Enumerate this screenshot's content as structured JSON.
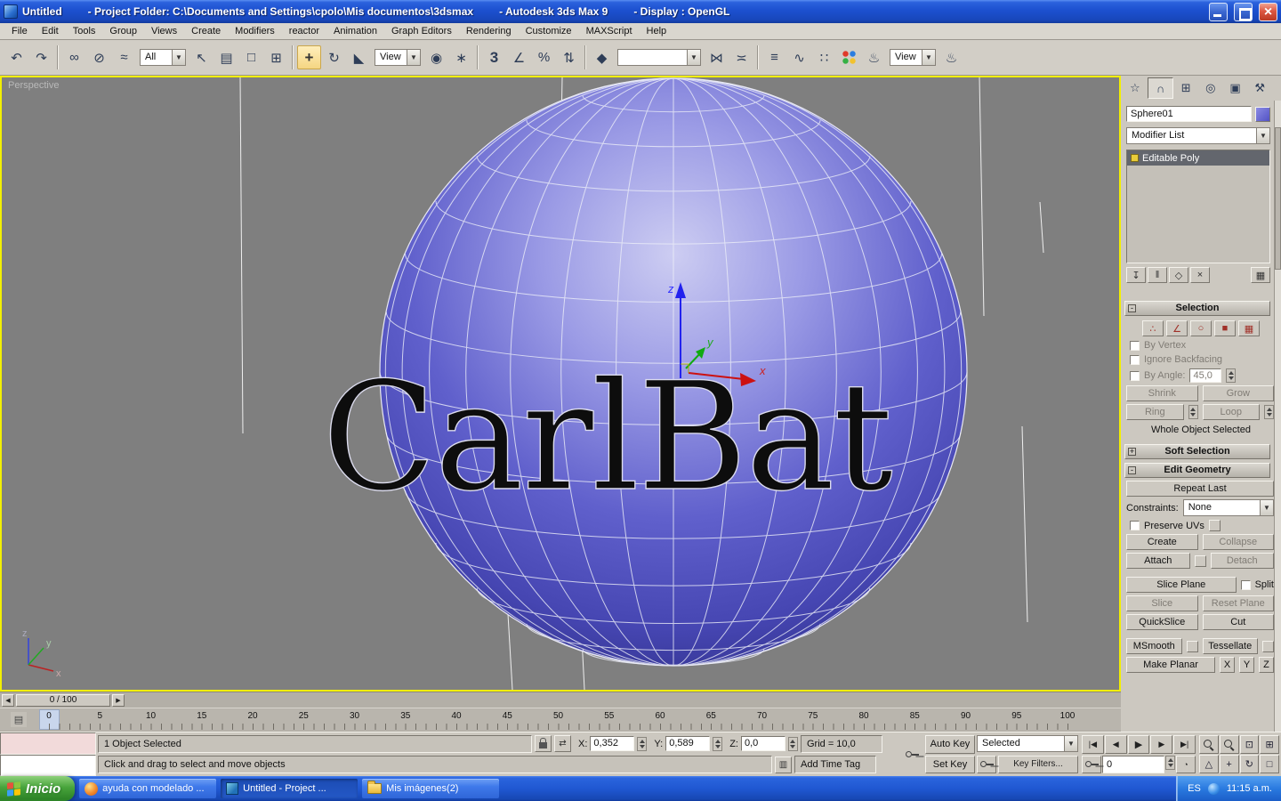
{
  "window": {
    "title_segments": [
      "Untitled",
      "- Project Folder: C:\\Documents and Settings\\cpolo\\Mis documentos\\3dsmax",
      "- Autodesk 3ds Max 9",
      "- Display : OpenGL"
    ]
  },
  "menu": {
    "items": [
      "File",
      "Edit",
      "Tools",
      "Group",
      "Views",
      "Create",
      "Modifiers",
      "reactor",
      "Animation",
      "Graph Editors",
      "Rendering",
      "Customize",
      "MAXScript",
      "Help"
    ]
  },
  "toolbar": {
    "selection_filter_value": "All",
    "coord_system_value": "View",
    "render_preset_value": "View"
  },
  "viewport": {
    "label": "Perspective",
    "object_text": "CarlBat",
    "gizmo": {
      "x": "x",
      "y": "y",
      "z": "z"
    },
    "world_axis": {
      "x": "x",
      "y": "y",
      "z": "z"
    }
  },
  "command_panel": {
    "object_name": "Sphere01",
    "modifier_list_label": "Modifier List",
    "stack_items": [
      {
        "label": "Editable Poly"
      }
    ],
    "selection": {
      "title": "Selection",
      "by_vertex": "By Vertex",
      "ignore_backfacing": "Ignore Backfacing",
      "by_angle": "By Angle:",
      "by_angle_value": "45,0",
      "shrink": "Shrink",
      "grow": "Grow",
      "ring": "Ring",
      "loop": "Loop",
      "status": "Whole Object Selected"
    },
    "soft_selection": {
      "title": "Soft Selection"
    },
    "edit_geometry": {
      "title": "Edit Geometry",
      "repeat_last": "Repeat Last",
      "constraints_label": "Constraints:",
      "constraints_value": "None",
      "preserve_uvs": "Preserve UVs",
      "create": "Create",
      "collapse": "Collapse",
      "attach": "Attach",
      "detach": "Detach",
      "slice_plane": "Slice Plane",
      "split": "Split",
      "slice": "Slice",
      "reset_plane": "Reset Plane",
      "quickslice": "QuickSlice",
      "cut": "Cut",
      "msmooth": "MSmooth",
      "tessellate": "Tessellate",
      "make_planar": "Make Planar",
      "axis_x": "X",
      "axis_y": "Y",
      "axis_z": "Z"
    }
  },
  "timeline": {
    "slider_label": "0 / 100",
    "ticks": [
      0,
      5,
      10,
      15,
      20,
      25,
      30,
      35,
      40,
      45,
      50,
      55,
      60,
      65,
      70,
      75,
      80,
      85,
      90,
      95,
      100
    ]
  },
  "status": {
    "selection_text": "1 Object Selected",
    "prompt_text": "Click and drag to select and move objects",
    "coord_x_label": "X:",
    "coord_x": "0,352",
    "coord_y_label": "Y:",
    "coord_y": "0,589",
    "coord_z_label": "Z:",
    "coord_z": "0,0",
    "grid_text": "Grid = 10,0",
    "time_tag_text": "Add Time Tag",
    "auto_key": "Auto Key",
    "set_key": "Set Key",
    "key_mode_value": "Selected",
    "key_filters": "Key Filters...",
    "current_frame": "0"
  },
  "taskbar": {
    "start_label": "Inicio",
    "tasks": [
      {
        "label": "ayuda con modelado ..."
      },
      {
        "label": "Untitled   - Project ..."
      },
      {
        "label": "Mis imágenes(2)"
      }
    ],
    "tray_language": "ES",
    "tray_time": "11:15 a.m."
  },
  "colors": {
    "active_viewport_border": "#f2ef00",
    "sphere_base": "#4d4dbd",
    "taskbar_blue": "#245edb",
    "start_green": "#379a37"
  },
  "icons": {
    "undo": "↶",
    "redo": "↷",
    "select_and_link": "∞",
    "unlink": "⊘",
    "bind_space_warp": "≈",
    "select_object": "↖",
    "select_by_name": "▤",
    "rect_region": "□",
    "window_crossing": "⊞",
    "move": "+",
    "rotate": "↻",
    "scale": "◣",
    "pivot_center": "◉",
    "manipulate": "∗",
    "snaps": "3",
    "angle_snap": "∠",
    "percent_snap": "%",
    "spinner_snap": "⇅",
    "named_sets": "◆",
    "mirror": "⋈",
    "align": "≍",
    "layers": "≡",
    "curve_editor": "∿",
    "schematic": "∷",
    "render": "♨",
    "quick_render": "♨",
    "dd_arrow": "▼",
    "tab_create": "☆",
    "tab_modify": "∩",
    "tab_hierarchy": "⊞",
    "tab_motion": "◎",
    "tab_display": "▣",
    "tab_utilities": "⚒",
    "pin_stack": "↧",
    "show_end_result": "‖",
    "make_unique": "◇",
    "remove_modifier": "×",
    "configure_sets": "▦",
    "sel_vertex": "∴",
    "sel_edge": "∠",
    "sel_border": "○",
    "sel_polygon": "■",
    "sel_element": "▦",
    "minus": "-",
    "plus": "+",
    "slider_prev": "◀",
    "slider_next": "▶",
    "track_tool": "▤",
    "go_start": "|◀",
    "prev_frame": "◀",
    "play": "▶",
    "next_frame": "▶",
    "go_end": "▶|",
    "time_config": "◔",
    "abs_offset": "⇄",
    "comm": "▥",
    "zoom_extents": "⊡",
    "zoom_extents_all": "⊞",
    "fov": "△",
    "pan": "+",
    "arc_rotate": "↻",
    "maximize": "□"
  }
}
